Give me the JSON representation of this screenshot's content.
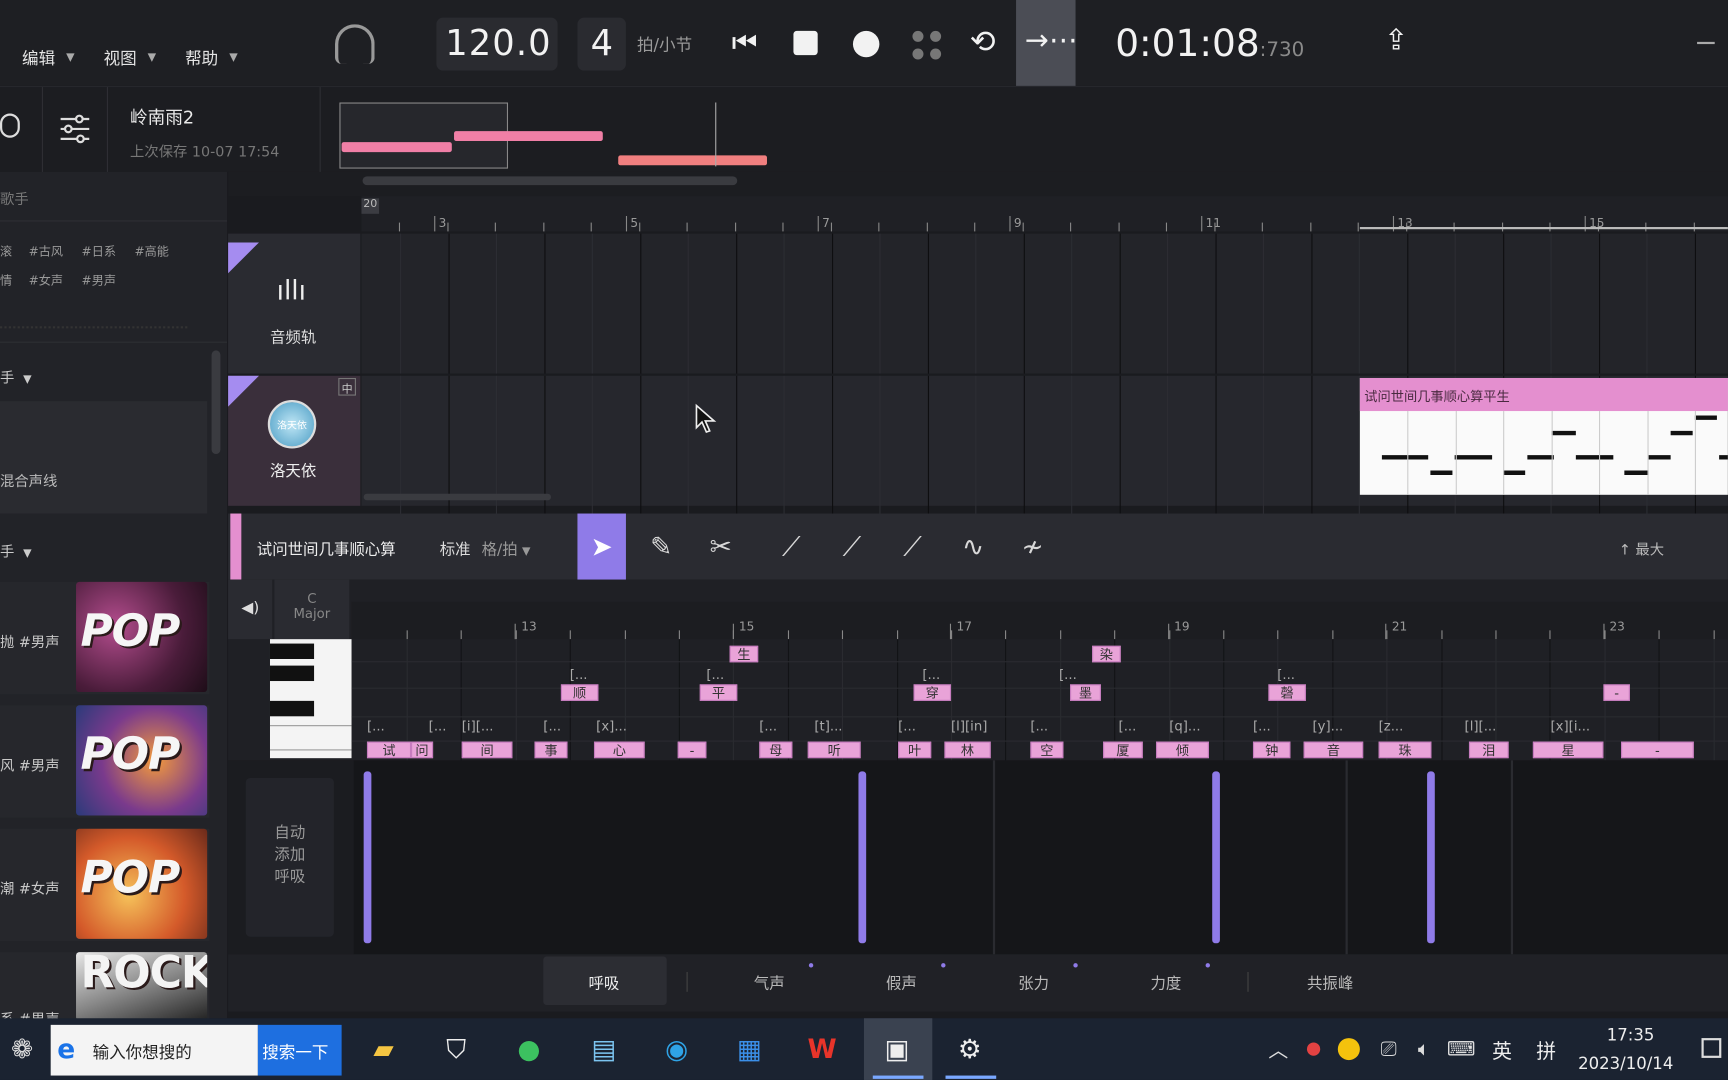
{
  "menu": {
    "edit": "编辑",
    "view": "视图",
    "help": "帮助"
  },
  "transport": {
    "tempo": "120.0",
    "beats": "4",
    "beats_unit": "拍/小节",
    "time_main": "0:01:08",
    "time_ms": ":730"
  },
  "project": {
    "name": "岭南雨2",
    "saved": "上次保存 10-07 17:54"
  },
  "sidebar": {
    "singer_header": "歌手",
    "tags_row1": [
      "滚",
      "#古风",
      "#日系",
      "#高能"
    ],
    "tags_row2": [
      "情",
      "#女声",
      "#男声"
    ],
    "section1": "手",
    "mix_label": "混合声线",
    "section2": "手",
    "cards": [
      {
        "label": "抛 #男声",
        "cover": "POP"
      },
      {
        "label": "风 #男声",
        "cover": "POP"
      },
      {
        "label": "潮 #女声",
        "cover": "POP"
      },
      {
        "label": "系 #男声",
        "cover": "ROCK"
      }
    ]
  },
  "ruler": {
    "start": "20",
    "bars": [
      "3",
      "5",
      "7",
      "9",
      "11",
      "13",
      "15"
    ]
  },
  "tracks": {
    "audio": {
      "label": "音频轨"
    },
    "singer": {
      "label": "洛天依",
      "avatar_text": "洛天依",
      "badge": "中",
      "clip_title": "试问世间几事顺心算平生"
    }
  },
  "pianoroll": {
    "clip_name": "试问世间几事顺心算",
    "mode": "标准",
    "grid": "格/拍",
    "key": "C",
    "scale": "Major",
    "max_label": "最大",
    "bars": [
      "13",
      "15",
      "17",
      "19",
      "21",
      "23"
    ],
    "notes_high": [
      "生",
      "染"
    ],
    "notes_mid": [
      "顺",
      "平",
      "穿",
      "墨",
      "磬",
      "-"
    ],
    "notes_low": [
      "试",
      "问",
      "间",
      "事",
      "心",
      "-",
      "母",
      "听",
      "叶",
      "林",
      "空",
      "厦",
      "倾",
      "钟",
      "音",
      "珠",
      "泪",
      "星",
      "-"
    ],
    "phonemes_mid": [
      "[...",
      "[...",
      "[...",
      "[...",
      "[..."
    ],
    "phonemes_low": [
      "[...",
      "[...",
      "[i][...",
      "[...",
      "[x]...",
      "[...",
      "[t]...",
      "[...",
      "[l][in]",
      "[...",
      "[...",
      "[q]...",
      "[...",
      "[y]...",
      "[z...",
      "[l][...",
      "[x][i..."
    ]
  },
  "breath": {
    "label": "自动\n添加\n呼吸",
    "line1": "自动",
    "line2": "添加",
    "line3": "呼吸"
  },
  "params": [
    "呼吸",
    "气声",
    "假声",
    "张力",
    "力度",
    "共振峰"
  ],
  "taskbar": {
    "search_placeholder": "输入你想搜的",
    "search_button": "搜索一下",
    "ime": "英",
    "ime2": "拼",
    "time": "17:35",
    "date": "2023/10/14"
  },
  "colors": {
    "accent": "#8f7be8",
    "note": "#e9a3d8",
    "clip": "#e48fcf",
    "bar_pink": "#f07fa6"
  }
}
